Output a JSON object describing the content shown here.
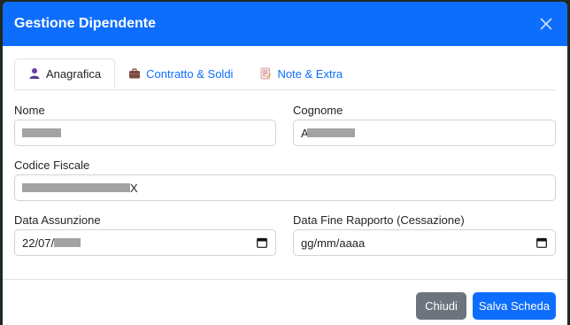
{
  "modal": {
    "title": "Gestione Dipendente",
    "close_icon": "close-icon"
  },
  "tabs": [
    {
      "label": "Anagrafica",
      "icon": "person-icon",
      "active": true
    },
    {
      "label": "Contratto & Soldi",
      "icon": "briefcase-icon",
      "active": false
    },
    {
      "label": "Note & Extra",
      "icon": "memo-icon",
      "active": false
    }
  ],
  "form": {
    "nome": {
      "label": "Nome",
      "value": ""
    },
    "cognome": {
      "label": "Cognome",
      "value": "A"
    },
    "codice_fiscale": {
      "label": "Codice Fiscale",
      "value": "X"
    },
    "data_assunzione": {
      "label": "Data Assunzione",
      "value": "22/07/"
    },
    "data_fine": {
      "label": "Data Fine Rapporto (Cessazione)",
      "value": "gg/mm/aaaa"
    }
  },
  "footer": {
    "close_label": "Chiudi",
    "save_label": "Salva Scheda"
  },
  "colors": {
    "header": "#0d6efd",
    "primary": "#0d6efd",
    "secondary": "#6c757d"
  }
}
